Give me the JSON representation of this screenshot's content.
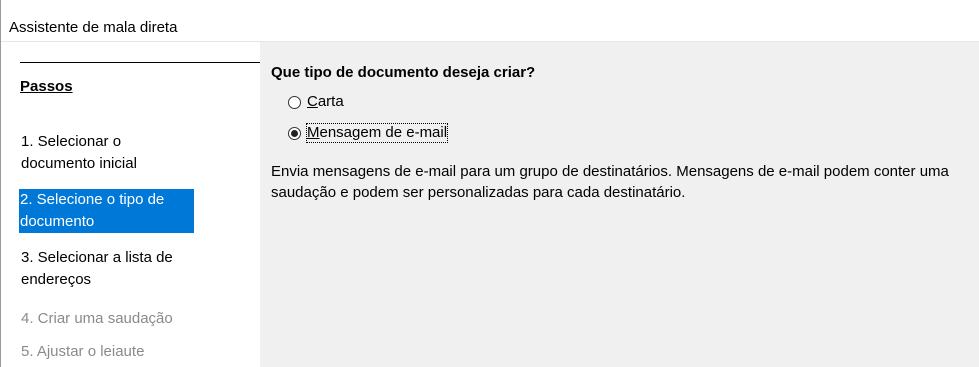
{
  "window": {
    "title": "Assistente de mala direta"
  },
  "sidebar": {
    "steps_title": "Passos",
    "steps": [
      {
        "label": "1. Selecionar o documento inicial",
        "state": "normal"
      },
      {
        "label": "2. Selecione o tipo de documento",
        "state": "selected"
      },
      {
        "label": "3. Selecionar a lista de endereços",
        "state": "normal"
      },
      {
        "label": "4. Criar uma saudação",
        "state": "disabled"
      },
      {
        "label": "5. Ajustar o leiaute",
        "state": "disabled"
      }
    ]
  },
  "main": {
    "question": "Que tipo de documento deseja criar?",
    "options": [
      {
        "mnemonic": "C",
        "rest": "arta",
        "checked": false
      },
      {
        "mnemonic": "M",
        "rest": "ensagem de e-mail",
        "checked": true
      }
    ],
    "description": "Envia mensagens de e-mail para um grupo de destinatários. Mensagens de e-mail podem conter uma saudação e podem ser personalizadas para cada destinatário."
  },
  "colors": {
    "selection": "#0078d7",
    "panel_background": "#f0f0f0",
    "disabled_text": "#8a8a8a"
  }
}
